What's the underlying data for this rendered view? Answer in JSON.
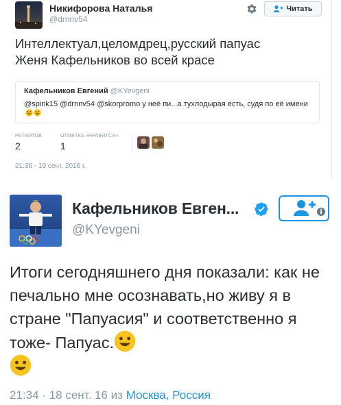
{
  "tweet1": {
    "author_name": "Никифорова Наталья",
    "author_handle": "@drnnv54",
    "follow_label": "Читать",
    "text_line1": "Интеллектуал,целомдрец,русский папуас",
    "text_line2": "Женя Кафельников во всей красе",
    "quote": {
      "name": "Кафельников Евгений",
      "handle": "@KYevgeni",
      "text": "@spirik15 @drnnv54 @skorpromo у неё пи...а тухлодырая есть, судя по её имени"
    },
    "retweets_label": "РЕТВИТОВ",
    "retweets_count": "2",
    "likes_label": "ОТМЕТКА «НРАВИТСЯ»",
    "likes_count": "1",
    "timestamp": "21:36 - 19 сент. 2016 г."
  },
  "tweet2": {
    "author_name": "Кафельников Евген...",
    "author_handle": "@KYevgeni",
    "text": "Итоги сегодняшнего дня показали: как не печально мне осознавать,но живу я в стране \"Папуасия\" и соответственно я тоже- Папуас.",
    "time": "21:34",
    "date": "18 сент. 16",
    "from_word": "из",
    "location": "Москва, Россия"
  },
  "colors": {
    "text": "#292f33",
    "muted": "#8899a6",
    "accent": "#1b95e0",
    "border": "#e1e8ed"
  },
  "icons": [
    "gear-icon",
    "follow-user-icon",
    "verified-badge-icon",
    "smile-emoji"
  ]
}
